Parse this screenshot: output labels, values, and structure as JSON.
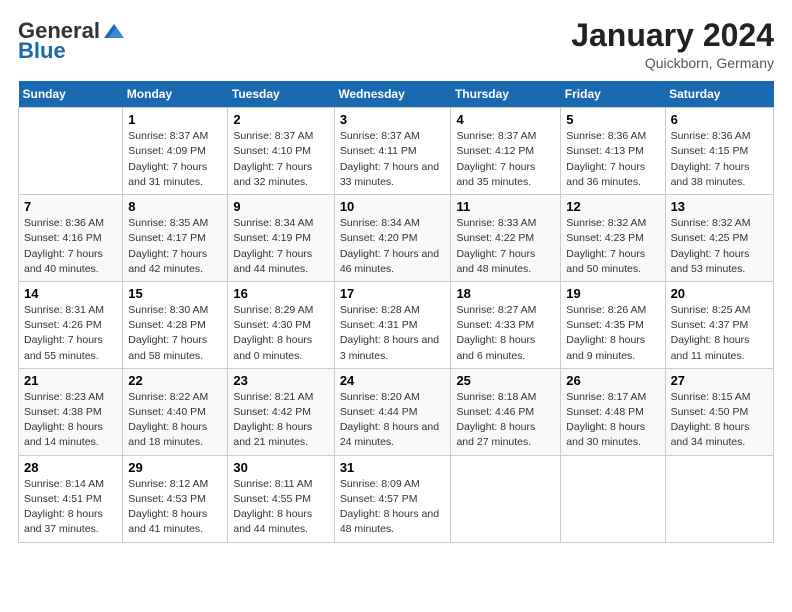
{
  "logo": {
    "general": "General",
    "blue": "Blue"
  },
  "title": "January 2024",
  "subtitle": "Quickborn, Germany",
  "days_header": [
    "Sunday",
    "Monday",
    "Tuesday",
    "Wednesday",
    "Thursday",
    "Friday",
    "Saturday"
  ],
  "weeks": [
    [
      {
        "num": "",
        "sunrise": "",
        "sunset": "",
        "daylight": ""
      },
      {
        "num": "1",
        "sunrise": "Sunrise: 8:37 AM",
        "sunset": "Sunset: 4:09 PM",
        "daylight": "Daylight: 7 hours and 31 minutes."
      },
      {
        "num": "2",
        "sunrise": "Sunrise: 8:37 AM",
        "sunset": "Sunset: 4:10 PM",
        "daylight": "Daylight: 7 hours and 32 minutes."
      },
      {
        "num": "3",
        "sunrise": "Sunrise: 8:37 AM",
        "sunset": "Sunset: 4:11 PM",
        "daylight": "Daylight: 7 hours and 33 minutes."
      },
      {
        "num": "4",
        "sunrise": "Sunrise: 8:37 AM",
        "sunset": "Sunset: 4:12 PM",
        "daylight": "Daylight: 7 hours and 35 minutes."
      },
      {
        "num": "5",
        "sunrise": "Sunrise: 8:36 AM",
        "sunset": "Sunset: 4:13 PM",
        "daylight": "Daylight: 7 hours and 36 minutes."
      },
      {
        "num": "6",
        "sunrise": "Sunrise: 8:36 AM",
        "sunset": "Sunset: 4:15 PM",
        "daylight": "Daylight: 7 hours and 38 minutes."
      }
    ],
    [
      {
        "num": "7",
        "sunrise": "Sunrise: 8:36 AM",
        "sunset": "Sunset: 4:16 PM",
        "daylight": "Daylight: 7 hours and 40 minutes."
      },
      {
        "num": "8",
        "sunrise": "Sunrise: 8:35 AM",
        "sunset": "Sunset: 4:17 PM",
        "daylight": "Daylight: 7 hours and 42 minutes."
      },
      {
        "num": "9",
        "sunrise": "Sunrise: 8:34 AM",
        "sunset": "Sunset: 4:19 PM",
        "daylight": "Daylight: 7 hours and 44 minutes."
      },
      {
        "num": "10",
        "sunrise": "Sunrise: 8:34 AM",
        "sunset": "Sunset: 4:20 PM",
        "daylight": "Daylight: 7 hours and 46 minutes."
      },
      {
        "num": "11",
        "sunrise": "Sunrise: 8:33 AM",
        "sunset": "Sunset: 4:22 PM",
        "daylight": "Daylight: 7 hours and 48 minutes."
      },
      {
        "num": "12",
        "sunrise": "Sunrise: 8:32 AM",
        "sunset": "Sunset: 4:23 PM",
        "daylight": "Daylight: 7 hours and 50 minutes."
      },
      {
        "num": "13",
        "sunrise": "Sunrise: 8:32 AM",
        "sunset": "Sunset: 4:25 PM",
        "daylight": "Daylight: 7 hours and 53 minutes."
      }
    ],
    [
      {
        "num": "14",
        "sunrise": "Sunrise: 8:31 AM",
        "sunset": "Sunset: 4:26 PM",
        "daylight": "Daylight: 7 hours and 55 minutes."
      },
      {
        "num": "15",
        "sunrise": "Sunrise: 8:30 AM",
        "sunset": "Sunset: 4:28 PM",
        "daylight": "Daylight: 7 hours and 58 minutes."
      },
      {
        "num": "16",
        "sunrise": "Sunrise: 8:29 AM",
        "sunset": "Sunset: 4:30 PM",
        "daylight": "Daylight: 8 hours and 0 minutes."
      },
      {
        "num": "17",
        "sunrise": "Sunrise: 8:28 AM",
        "sunset": "Sunset: 4:31 PM",
        "daylight": "Daylight: 8 hours and 3 minutes."
      },
      {
        "num": "18",
        "sunrise": "Sunrise: 8:27 AM",
        "sunset": "Sunset: 4:33 PM",
        "daylight": "Daylight: 8 hours and 6 minutes."
      },
      {
        "num": "19",
        "sunrise": "Sunrise: 8:26 AM",
        "sunset": "Sunset: 4:35 PM",
        "daylight": "Daylight: 8 hours and 9 minutes."
      },
      {
        "num": "20",
        "sunrise": "Sunrise: 8:25 AM",
        "sunset": "Sunset: 4:37 PM",
        "daylight": "Daylight: 8 hours and 11 minutes."
      }
    ],
    [
      {
        "num": "21",
        "sunrise": "Sunrise: 8:23 AM",
        "sunset": "Sunset: 4:38 PM",
        "daylight": "Daylight: 8 hours and 14 minutes."
      },
      {
        "num": "22",
        "sunrise": "Sunrise: 8:22 AM",
        "sunset": "Sunset: 4:40 PM",
        "daylight": "Daylight: 8 hours and 18 minutes."
      },
      {
        "num": "23",
        "sunrise": "Sunrise: 8:21 AM",
        "sunset": "Sunset: 4:42 PM",
        "daylight": "Daylight: 8 hours and 21 minutes."
      },
      {
        "num": "24",
        "sunrise": "Sunrise: 8:20 AM",
        "sunset": "Sunset: 4:44 PM",
        "daylight": "Daylight: 8 hours and 24 minutes."
      },
      {
        "num": "25",
        "sunrise": "Sunrise: 8:18 AM",
        "sunset": "Sunset: 4:46 PM",
        "daylight": "Daylight: 8 hours and 27 minutes."
      },
      {
        "num": "26",
        "sunrise": "Sunrise: 8:17 AM",
        "sunset": "Sunset: 4:48 PM",
        "daylight": "Daylight: 8 hours and 30 minutes."
      },
      {
        "num": "27",
        "sunrise": "Sunrise: 8:15 AM",
        "sunset": "Sunset: 4:50 PM",
        "daylight": "Daylight: 8 hours and 34 minutes."
      }
    ],
    [
      {
        "num": "28",
        "sunrise": "Sunrise: 8:14 AM",
        "sunset": "Sunset: 4:51 PM",
        "daylight": "Daylight: 8 hours and 37 minutes."
      },
      {
        "num": "29",
        "sunrise": "Sunrise: 8:12 AM",
        "sunset": "Sunset: 4:53 PM",
        "daylight": "Daylight: 8 hours and 41 minutes."
      },
      {
        "num": "30",
        "sunrise": "Sunrise: 8:11 AM",
        "sunset": "Sunset: 4:55 PM",
        "daylight": "Daylight: 8 hours and 44 minutes."
      },
      {
        "num": "31",
        "sunrise": "Sunrise: 8:09 AM",
        "sunset": "Sunset: 4:57 PM",
        "daylight": "Daylight: 8 hours and 48 minutes."
      },
      {
        "num": "",
        "sunrise": "",
        "sunset": "",
        "daylight": ""
      },
      {
        "num": "",
        "sunrise": "",
        "sunset": "",
        "daylight": ""
      },
      {
        "num": "",
        "sunrise": "",
        "sunset": "",
        "daylight": ""
      }
    ]
  ]
}
